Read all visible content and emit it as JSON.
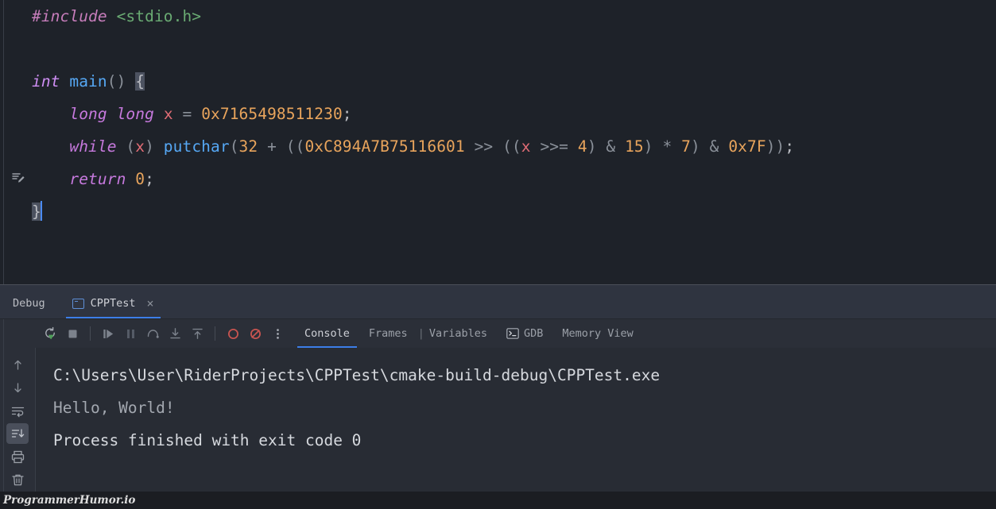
{
  "editor": {
    "background": "#1E2229",
    "lines": [
      {
        "id": "l1",
        "tokens": [
          {
            "t": "#include",
            "c": "t-pre"
          },
          {
            "t": " ",
            "c": "t-punct"
          },
          {
            "t": "<stdio.h>",
            "c": "t-str"
          }
        ]
      },
      {
        "id": "l2",
        "tokens": []
      },
      {
        "id": "l3",
        "tokens": [
          {
            "t": "int",
            "c": "t-kw"
          },
          {
            "t": " ",
            "c": "t-punct"
          },
          {
            "t": "main",
            "c": "t-fn"
          },
          {
            "t": "()",
            "c": "t-paren"
          },
          {
            "t": " ",
            "c": "t-punct"
          },
          {
            "t": "{",
            "c": "brace-hl"
          }
        ]
      },
      {
        "id": "l4",
        "tokens": [
          {
            "t": "    ",
            "c": "t-punct"
          },
          {
            "t": "long",
            "c": "t-kw2"
          },
          {
            "t": " ",
            "c": "t-punct"
          },
          {
            "t": "long",
            "c": "t-kw2"
          },
          {
            "t": " ",
            "c": "t-punct"
          },
          {
            "t": "x",
            "c": "t-var"
          },
          {
            "t": " ",
            "c": "t-punct"
          },
          {
            "t": "=",
            "c": "t-op"
          },
          {
            "t": " ",
            "c": "t-punct"
          },
          {
            "t": "0x7165498511230",
            "c": "t-num"
          },
          {
            "t": ";",
            "c": "t-punct"
          }
        ]
      },
      {
        "id": "l5",
        "tokens": [
          {
            "t": "    ",
            "c": "t-punct"
          },
          {
            "t": "while",
            "c": "t-kw2"
          },
          {
            "t": " ",
            "c": "t-punct"
          },
          {
            "t": "(",
            "c": "t-paren"
          },
          {
            "t": "x",
            "c": "t-var"
          },
          {
            "t": ")",
            "c": "t-paren"
          },
          {
            "t": " ",
            "c": "t-punct"
          },
          {
            "t": "putchar",
            "c": "t-fn"
          },
          {
            "t": "(",
            "c": "t-paren"
          },
          {
            "t": "32",
            "c": "t-num"
          },
          {
            "t": " ",
            "c": "t-punct"
          },
          {
            "t": "+",
            "c": "t-op"
          },
          {
            "t": " ",
            "c": "t-punct"
          },
          {
            "t": "((",
            "c": "t-paren"
          },
          {
            "t": "0xC894A7B75116601",
            "c": "t-num"
          },
          {
            "t": " ",
            "c": "t-punct"
          },
          {
            "t": ">>",
            "c": "t-op"
          },
          {
            "t": " ",
            "c": "t-punct"
          },
          {
            "t": "((",
            "c": "t-paren"
          },
          {
            "t": "x",
            "c": "t-var"
          },
          {
            "t": " ",
            "c": "t-punct"
          },
          {
            "t": ">>=",
            "c": "t-op"
          },
          {
            "t": " ",
            "c": "t-punct"
          },
          {
            "t": "4",
            "c": "t-num"
          },
          {
            "t": ")",
            "c": "t-paren"
          },
          {
            "t": " ",
            "c": "t-punct"
          },
          {
            "t": "&",
            "c": "t-op"
          },
          {
            "t": " ",
            "c": "t-punct"
          },
          {
            "t": "15",
            "c": "t-num"
          },
          {
            "t": ")",
            "c": "t-paren"
          },
          {
            "t": " ",
            "c": "t-punct"
          },
          {
            "t": "*",
            "c": "t-op"
          },
          {
            "t": " ",
            "c": "t-punct"
          },
          {
            "t": "7",
            "c": "t-num"
          },
          {
            "t": ")",
            "c": "t-paren"
          },
          {
            "t": " ",
            "c": "t-punct"
          },
          {
            "t": "&",
            "c": "t-op"
          },
          {
            "t": " ",
            "c": "t-punct"
          },
          {
            "t": "0x7F",
            "c": "t-num"
          },
          {
            "t": "))",
            "c": "t-paren"
          },
          {
            "t": ";",
            "c": "t-punct"
          }
        ]
      },
      {
        "id": "l6",
        "tokens": [
          {
            "t": "    ",
            "c": "t-punct"
          },
          {
            "t": "return",
            "c": "t-kw2"
          },
          {
            "t": " ",
            "c": "t-punct"
          },
          {
            "t": "0",
            "c": "t-num"
          },
          {
            "t": ";",
            "c": "t-punct"
          }
        ]
      },
      {
        "id": "l7",
        "tokens": [
          {
            "t": "}",
            "c": "brace-hl"
          }
        ],
        "caret": true
      }
    ],
    "gutter": {
      "edit_icon_name": "edit-pencil-icon"
    },
    "plain_text": "#include <stdio.h>\n\nint main() {\n    long long x = 0x7165498511230;\n    while (x) putchar(32 + ((0xC894A7B75116601 >> ((x >>= 4) & 15) * 7) & 0x7F));\n    return 0;\n}"
  },
  "debug": {
    "title": "Debug",
    "session_tab": {
      "label": "CPPTest",
      "close_label": "×",
      "active": true
    },
    "toolbar_buttons": [
      {
        "name": "rerun-button",
        "title": "Rerun"
      },
      {
        "name": "stop-button",
        "title": "Stop"
      },
      {
        "name": "resume-button",
        "title": "Resume Program"
      },
      {
        "name": "pause-button",
        "title": "Pause Program"
      },
      {
        "name": "step-over-button",
        "title": "Step Over"
      },
      {
        "name": "step-into-button",
        "title": "Step Into"
      },
      {
        "name": "step-out-button",
        "title": "Step Out"
      },
      {
        "name": "view-breakpoints-button",
        "title": "View Breakpoints"
      },
      {
        "name": "mute-breakpoints-button",
        "title": "Mute Breakpoints"
      },
      {
        "name": "more-options-button",
        "title": "More"
      }
    ],
    "tabs": [
      {
        "label": "Console",
        "active": true,
        "icon": null
      },
      {
        "label": "Frames",
        "active": false,
        "icon": null
      },
      {
        "label": "Variables",
        "active": false,
        "icon": null,
        "divider_before": true
      },
      {
        "label": "GDB",
        "active": false,
        "icon": "terminal-icon"
      },
      {
        "label": "Memory View",
        "active": false,
        "icon": null
      }
    ],
    "side_buttons": [
      {
        "name": "scroll-up-button",
        "title": "Up"
      },
      {
        "name": "scroll-down-button",
        "title": "Down"
      },
      {
        "name": "soft-wrap-button",
        "title": "Soft-Wrap"
      },
      {
        "name": "scroll-to-end-button",
        "title": "Scroll to the end",
        "active": true
      },
      {
        "name": "print-button",
        "title": "Print"
      },
      {
        "name": "clear-all-button",
        "title": "Clear All"
      }
    ],
    "console": {
      "lines": [
        {
          "text": "C:\\Users\\User\\RiderProjects\\CPPTest\\cmake-build-debug\\CPPTest.exe",
          "style": "cl-path"
        },
        {
          "text": "Hello, World!",
          "style": "cl-out"
        },
        {
          "text": "Process finished with exit code 0",
          "style": "cl-fin"
        }
      ]
    }
  },
  "watermark": {
    "text": "ProgrammerHumor.io"
  },
  "colors": {
    "editor_bg": "#1E2229",
    "panel_bg": "#2B2F38",
    "header_bg": "#2F3440",
    "console_bg": "#282C34",
    "accent_blue": "#3C7EE8",
    "caret_blue": "#4A8BF5",
    "keyword_magenta": "#C679DD",
    "string_green": "#6AAB73",
    "number_orange": "#E8A45C",
    "function_blue": "#56A8F5",
    "variable_red": "#E06C75",
    "breakpoint_red": "#C75450",
    "text_default": "#BCBEC4"
  }
}
